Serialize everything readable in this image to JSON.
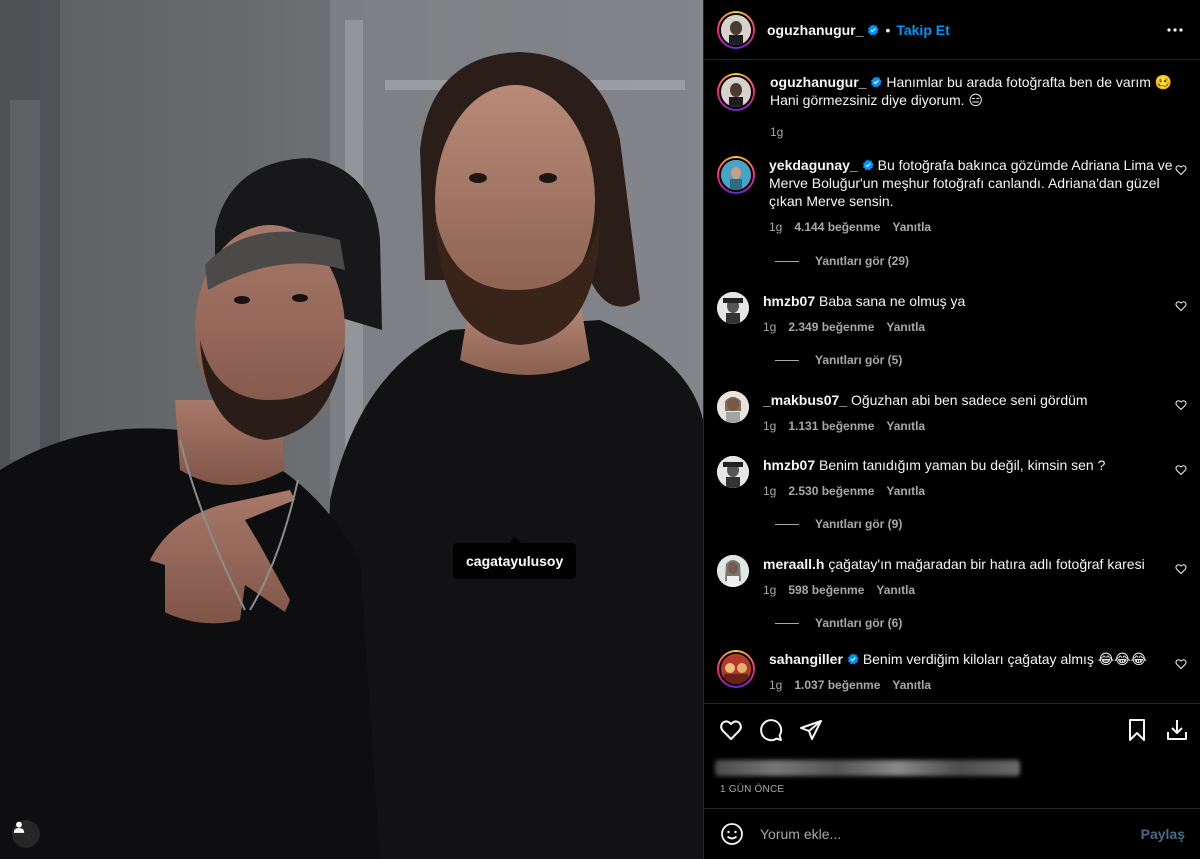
{
  "post": {
    "author": "oguzhanugur_",
    "follow_label": "Takip Et",
    "dot": "•",
    "tag": "cagatayulusoy",
    "caption": {
      "username": "oguzhanugur_",
      "text": "Hanımlar bu arada fotoğrafta ben de varım 🥴 Hani görmezsiniz diye diyorum. 😑",
      "time": "1g"
    },
    "time_ago": "1 GÜN ÖNCE"
  },
  "comments": [
    {
      "username": "yekdagunay_",
      "verified": true,
      "text": "Bu fotoğrafa bakınca gözümde Adriana Lima ve Merve Boluğur'un meşhur fotoğrafı canlandı. Adriana'dan güzel çıkan Merve sensin.",
      "time": "1g",
      "likes": "4.144 beğenme",
      "reply": "Yanıtla",
      "view_replies": "Yanıtları gör (29)"
    },
    {
      "username": "hmzb07",
      "verified": false,
      "text": "Baba sana ne olmuş ya",
      "time": "1g",
      "likes": "2.349 beğenme",
      "reply": "Yanıtla",
      "view_replies": "Yanıtları gör (5)"
    },
    {
      "username": "_makbus07_",
      "verified": false,
      "text": "Oğuzhan abi ben sadece seni gördüm",
      "time": "1g",
      "likes": "1.131 beğenme",
      "reply": "Yanıtla",
      "view_replies": ""
    },
    {
      "username": "hmzb07",
      "verified": false,
      "text": "Benim tanıdığım yaman bu değil, kimsin sen ?",
      "time": "1g",
      "likes": "2.530 beğenme",
      "reply": "Yanıtla",
      "view_replies": "Yanıtları gör (9)"
    },
    {
      "username": "meraall.h",
      "verified": false,
      "text": "çağatay'ın mağaradan bir hatıra adlı fotoğraf karesi",
      "time": "1g",
      "likes": "598 beğenme",
      "reply": "Yanıtla",
      "view_replies": "Yanıtları gör (6)"
    },
    {
      "username": "sahangiller",
      "verified": true,
      "text": "Benim verdiğim kiloları çağatay almış 😂😂😂",
      "time": "1g",
      "likes": "1.037 beğenme",
      "reply": "Yanıtla",
      "view_replies": ""
    }
  ],
  "compose": {
    "placeholder": "Yorum ekle...",
    "share_label": "Paylaş"
  },
  "icons": [
    "more-options-icon",
    "verified-badge-icon",
    "heart-icon",
    "comment-icon",
    "share-icon",
    "save-icon",
    "download-icon",
    "emoji-icon",
    "user-tag-icon"
  ],
  "colors": {
    "accent": "#0095f6",
    "background": "#000000",
    "secondary_text": "#a8a8a8",
    "divider": "#262626"
  }
}
